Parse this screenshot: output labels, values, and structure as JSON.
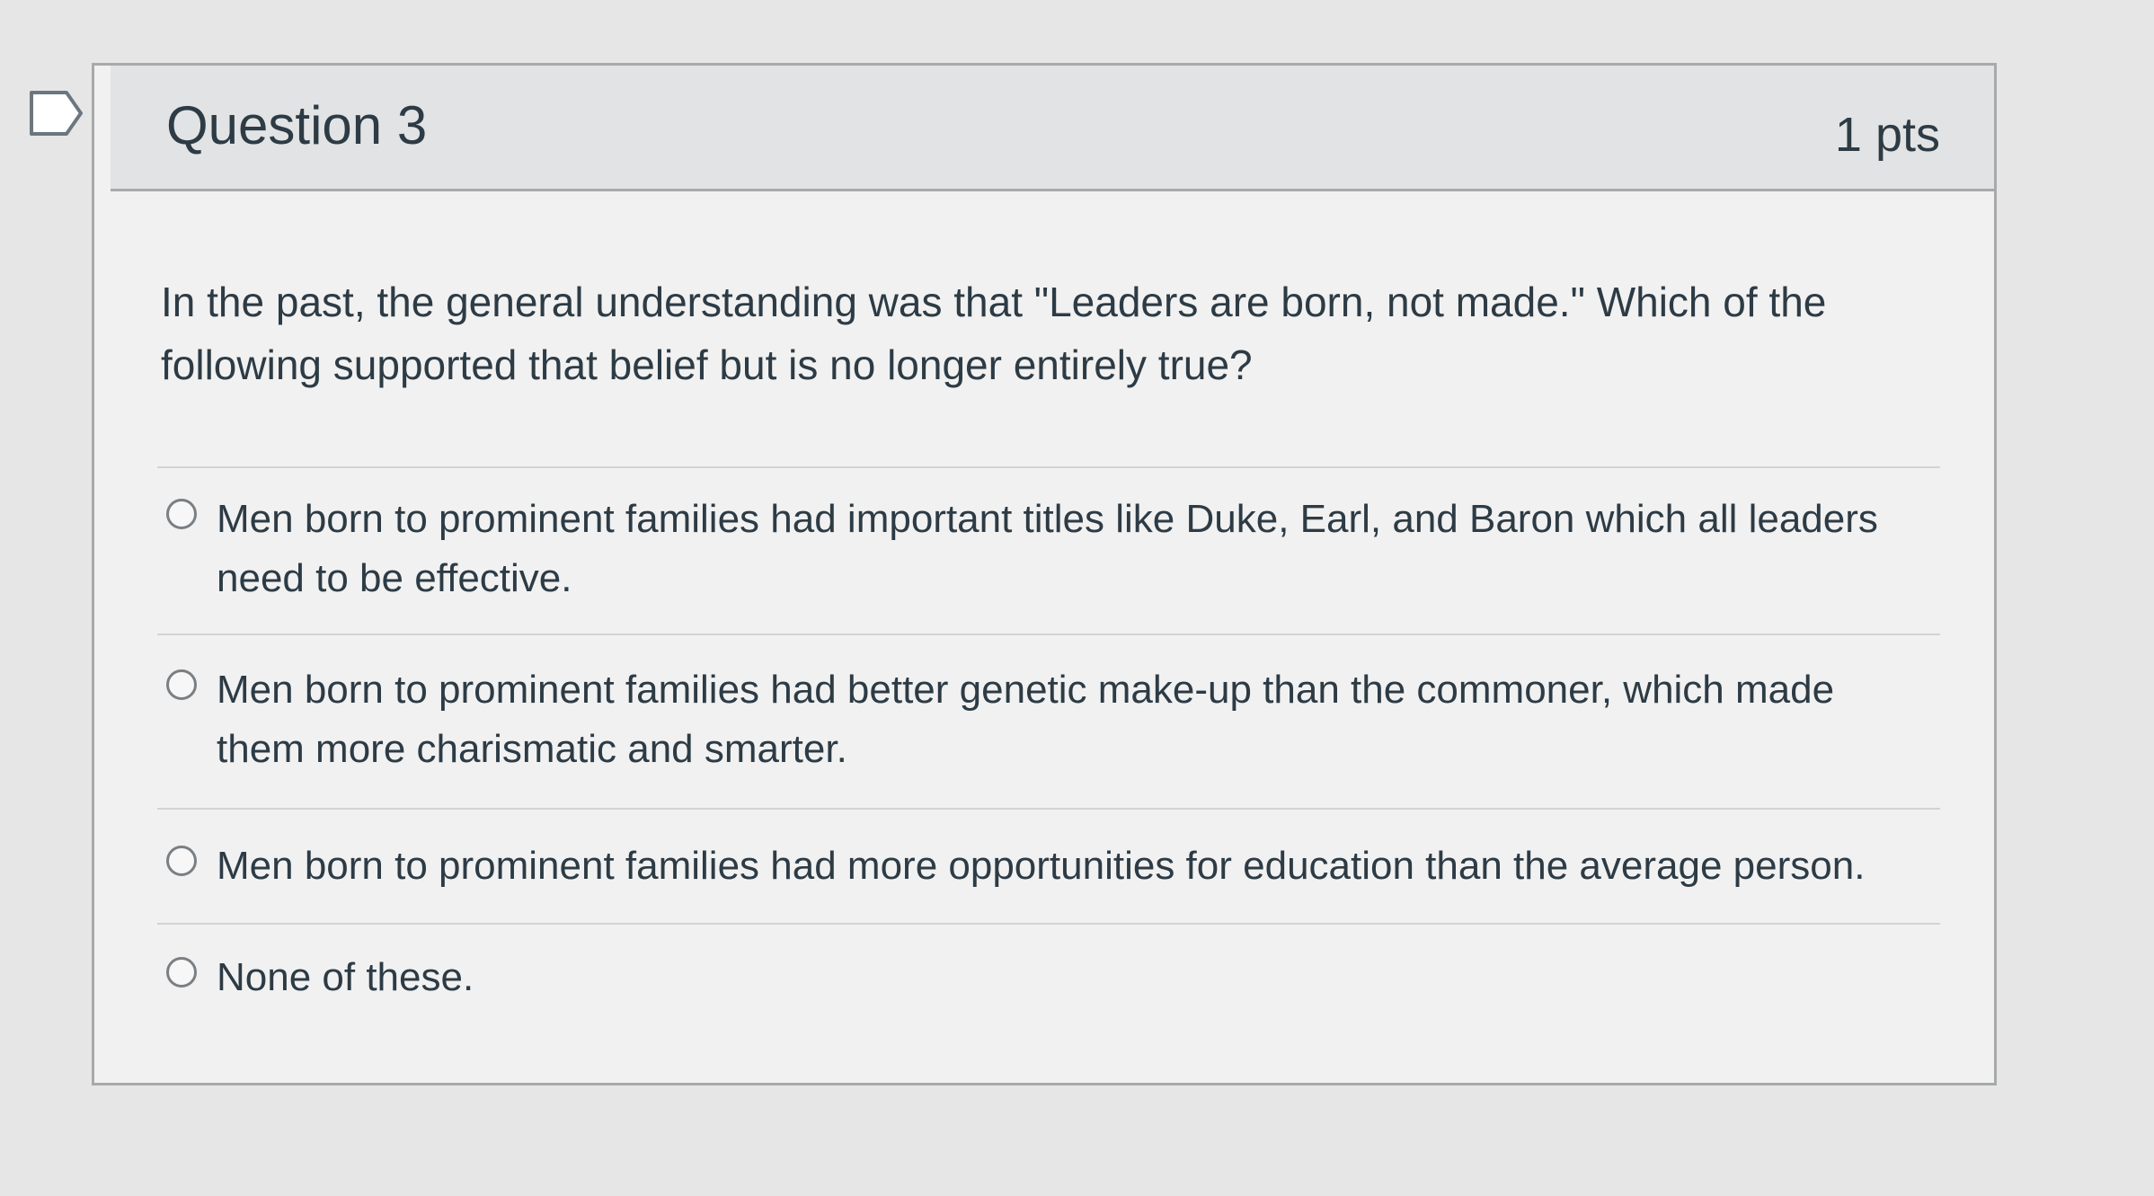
{
  "question": {
    "title": "Question 3",
    "points": "1 pts",
    "text": "In the past, the general understanding was that \"Leaders are born, not made.\"  Which of the following supported that belief but is no longer entirely true?",
    "answers": [
      {
        "label": "Men born to prominent families had important titles like Duke, Earl, and Baron which all leaders need to be effective.",
        "selected": false
      },
      {
        "label": "Men born to prominent families had better genetic make-up than the commoner, which made them more charismatic and smarter.",
        "selected": false
      },
      {
        "label": "Men born to prominent families had more opportunities for education than the average person.",
        "selected": false
      },
      {
        "label": "None of these.",
        "selected": false
      }
    ]
  }
}
